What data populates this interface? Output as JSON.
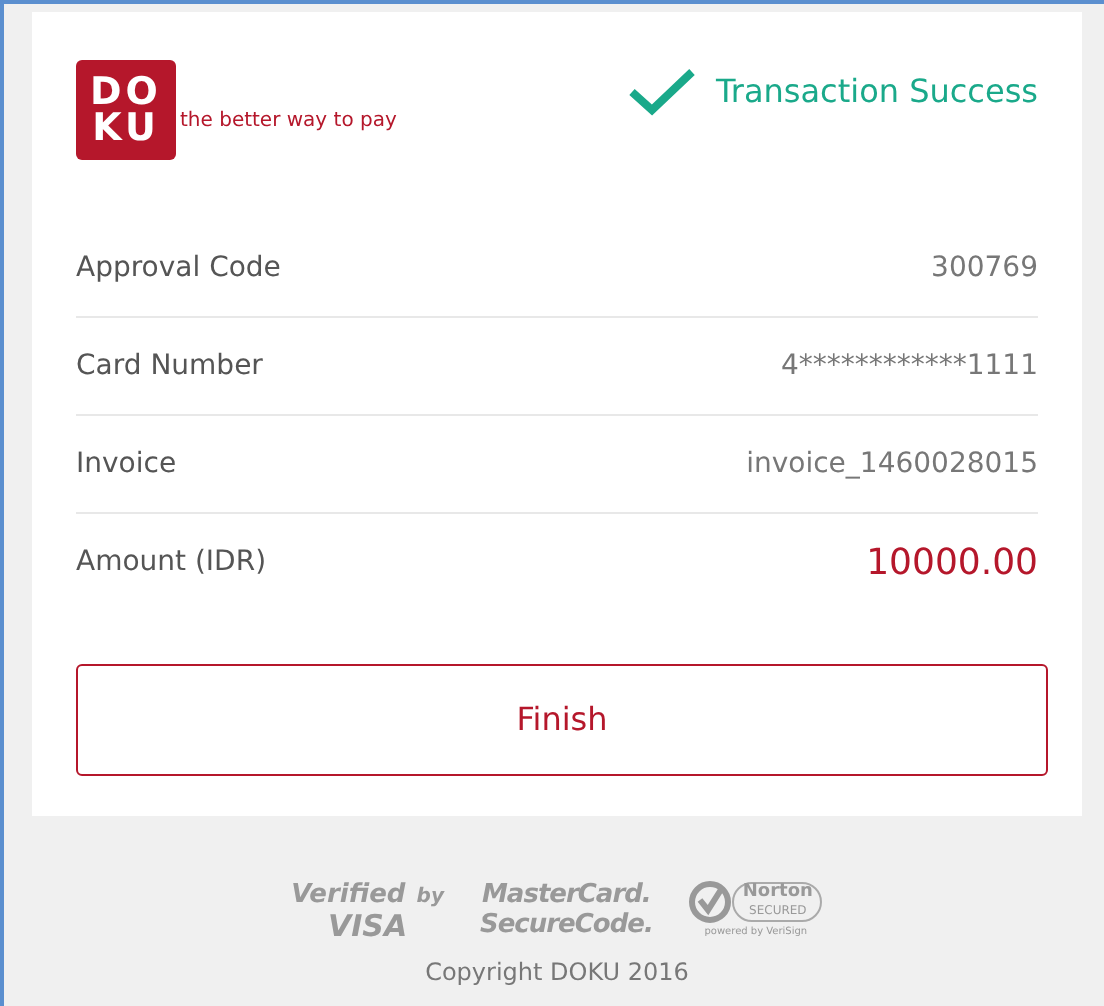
{
  "brand": {
    "logo_top": "DO",
    "logo_bottom": "KU",
    "tagline": "the better way to pay"
  },
  "status": {
    "text": "Transaction Success"
  },
  "details": [
    {
      "label": "Approval Code",
      "value": "300769",
      "kind": "plain"
    },
    {
      "label": "Card Number",
      "value": "4************1111",
      "kind": "plain"
    },
    {
      "label": "Invoice",
      "value": "invoice_1460028015",
      "kind": "plain"
    },
    {
      "label": "Amount (IDR)",
      "value": "10000.00",
      "kind": "amount"
    }
  ],
  "finish_button": "Finish",
  "badges": [
    {
      "kind": "visa",
      "line1": "Verified",
      "line1b": "by",
      "line2": "VISA"
    },
    {
      "kind": "mastercard",
      "line1": "MasterCard.",
      "line2": "SecureCode."
    },
    {
      "kind": "norton",
      "line1": "Norton",
      "line2": "SECURED",
      "line3": "powered by VeriSign"
    }
  ],
  "copyright": "Copyright DOKU 2016"
}
